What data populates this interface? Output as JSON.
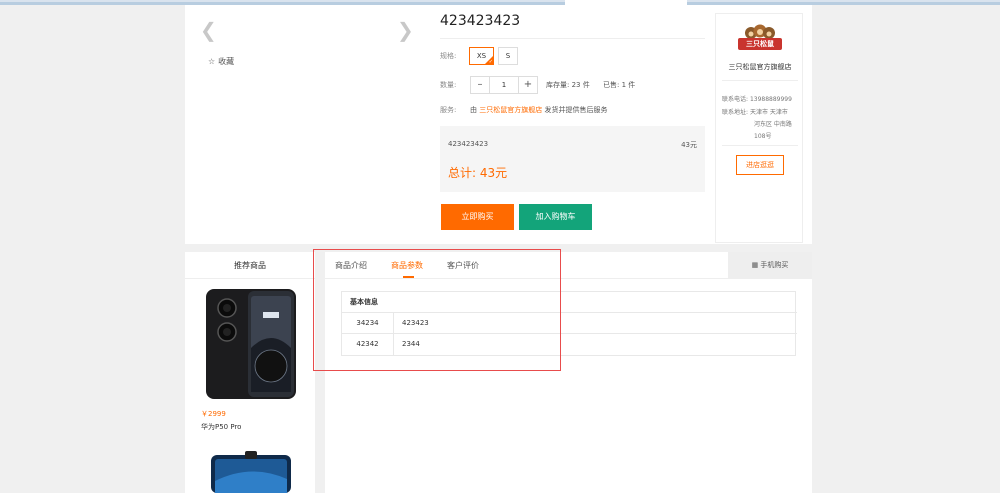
{
  "product": {
    "title": "423423423",
    "favorite_label": "收藏",
    "spec_label": "规格:",
    "specs": [
      "XS",
      "S"
    ],
    "quantity_label": "数量:",
    "quantity_value": "1",
    "stock_text": "库存量: 23 件",
    "sold_text": "已售: 1 件",
    "service_label": "服务:",
    "service_prefix": "由",
    "service_shop": "三只松鼠官方旗舰店",
    "service_suffix": "发货并提供售后服务",
    "summary_name": "423423423",
    "summary_price": "43元",
    "total_text": "总计: 43元",
    "buy_now_label": "立即购买",
    "add_cart_label": "加入购物车"
  },
  "store": {
    "logo_text": "三只松鼠",
    "name": "三只松鼠官方旗舰店",
    "phone_label": "联系电话:",
    "phone_value": "13988889999",
    "address_label": "联系地址:",
    "address_line1": "天津市 天津市",
    "address_line2": "河东区 中南路",
    "address_line3": "108号",
    "enter_label": "进店逛逛"
  },
  "recommend": {
    "title": "推荐商品",
    "items": [
      {
        "price": "￥2999",
        "name": "华为P50 Pro"
      }
    ]
  },
  "detail": {
    "tabs": [
      "商品介绍",
      "商品参数",
      "客户评价"
    ],
    "active_tab": "商品参数",
    "mobile_buy_label": "手机购买",
    "params_title": "基本信息",
    "params": [
      {
        "key": "34234",
        "value": "423423"
      },
      {
        "key": "42342",
        "value": "2344"
      }
    ]
  },
  "colors": {
    "accent": "#ff6a00",
    "cart_green": "#13a47a",
    "highlight_box": "#e84c4c"
  }
}
